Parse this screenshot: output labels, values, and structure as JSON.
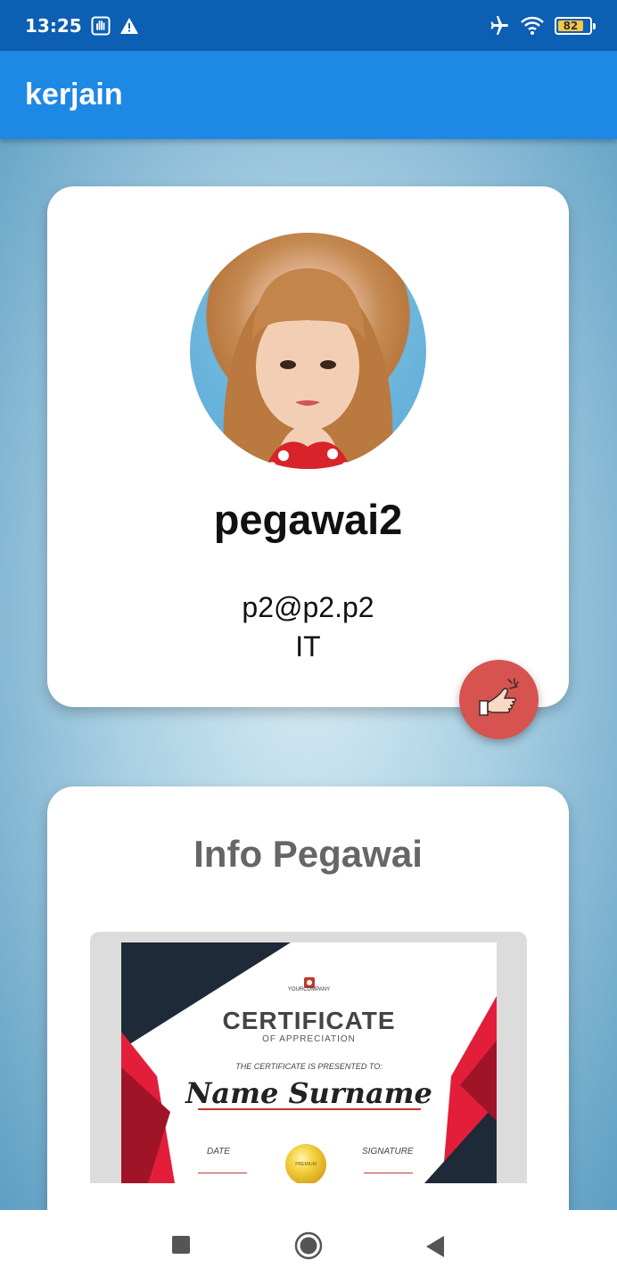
{
  "status_bar": {
    "time": "13:25",
    "icons": [
      "hand-notification-icon",
      "warning-icon",
      "airplane-icon",
      "wifi-icon",
      "battery-icon"
    ],
    "battery_level": "82"
  },
  "app_bar": {
    "title": "kerjain"
  },
  "profile": {
    "name": "pegawai2",
    "email": "p2@p2.p2",
    "department": "IT",
    "fab_icon": "punch-out-hand-icon"
  },
  "info": {
    "title": "Info Pegawai",
    "certificate": {
      "company": "YOURCOMPANY",
      "title": "CERTIFICATE",
      "subtitle": "OF APPRECIATION",
      "presented": "THE CERTIFICATE IS PRESENTED TO:",
      "name": "Name Surname",
      "date_label": "DATE",
      "signature_label": "SIGNATURE",
      "seal_text": "PREMIUM"
    }
  },
  "nav_bar": {
    "buttons": [
      "recents-square-icon",
      "home-circle-icon",
      "back-triangle-icon"
    ]
  },
  "colors": {
    "status_bar": "#0d5fb3",
    "app_bar": "#1e88e5",
    "fab": "#d65350"
  }
}
